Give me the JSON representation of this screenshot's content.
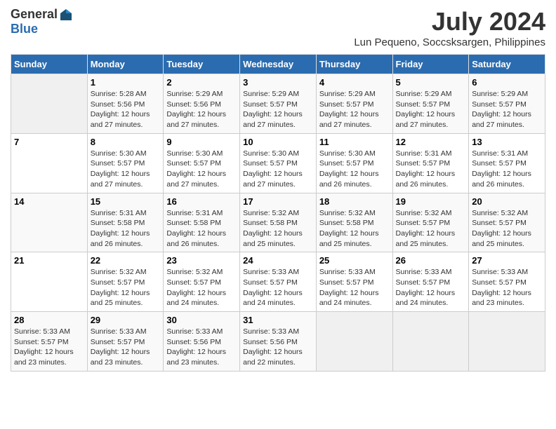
{
  "header": {
    "logo_general": "General",
    "logo_blue": "Blue",
    "month_year": "July 2024",
    "location": "Lun Pequeno, Soccsksargen, Philippines"
  },
  "calendar": {
    "days_of_week": [
      "Sunday",
      "Monday",
      "Tuesday",
      "Wednesday",
      "Thursday",
      "Friday",
      "Saturday"
    ],
    "weeks": [
      [
        {
          "day": "",
          "info": ""
        },
        {
          "day": "1",
          "info": "Sunrise: 5:28 AM\nSunset: 5:56 PM\nDaylight: 12 hours\nand 27 minutes."
        },
        {
          "day": "2",
          "info": "Sunrise: 5:29 AM\nSunset: 5:56 PM\nDaylight: 12 hours\nand 27 minutes."
        },
        {
          "day": "3",
          "info": "Sunrise: 5:29 AM\nSunset: 5:57 PM\nDaylight: 12 hours\nand 27 minutes."
        },
        {
          "day": "4",
          "info": "Sunrise: 5:29 AM\nSunset: 5:57 PM\nDaylight: 12 hours\nand 27 minutes."
        },
        {
          "day": "5",
          "info": "Sunrise: 5:29 AM\nSunset: 5:57 PM\nDaylight: 12 hours\nand 27 minutes."
        },
        {
          "day": "6",
          "info": "Sunrise: 5:29 AM\nSunset: 5:57 PM\nDaylight: 12 hours\nand 27 minutes."
        }
      ],
      [
        {
          "day": "7",
          "info": ""
        },
        {
          "day": "8",
          "info": "Sunrise: 5:30 AM\nSunset: 5:57 PM\nDaylight: 12 hours\nand 27 minutes."
        },
        {
          "day": "9",
          "info": "Sunrise: 5:30 AM\nSunset: 5:57 PM\nDaylight: 12 hours\nand 27 minutes."
        },
        {
          "day": "10",
          "info": "Sunrise: 5:30 AM\nSunset: 5:57 PM\nDaylight: 12 hours\nand 27 minutes."
        },
        {
          "day": "11",
          "info": "Sunrise: 5:30 AM\nSunset: 5:57 PM\nDaylight: 12 hours\nand 26 minutes."
        },
        {
          "day": "12",
          "info": "Sunrise: 5:31 AM\nSunset: 5:57 PM\nDaylight: 12 hours\nand 26 minutes."
        },
        {
          "day": "13",
          "info": "Sunrise: 5:31 AM\nSunset: 5:57 PM\nDaylight: 12 hours\nand 26 minutes."
        }
      ],
      [
        {
          "day": "14",
          "info": ""
        },
        {
          "day": "15",
          "info": "Sunrise: 5:31 AM\nSunset: 5:58 PM\nDaylight: 12 hours\nand 26 minutes."
        },
        {
          "day": "16",
          "info": "Sunrise: 5:31 AM\nSunset: 5:58 PM\nDaylight: 12 hours\nand 26 minutes."
        },
        {
          "day": "17",
          "info": "Sunrise: 5:32 AM\nSunset: 5:58 PM\nDaylight: 12 hours\nand 25 minutes."
        },
        {
          "day": "18",
          "info": "Sunrise: 5:32 AM\nSunset: 5:58 PM\nDaylight: 12 hours\nand 25 minutes."
        },
        {
          "day": "19",
          "info": "Sunrise: 5:32 AM\nSunset: 5:57 PM\nDaylight: 12 hours\nand 25 minutes."
        },
        {
          "day": "20",
          "info": "Sunrise: 5:32 AM\nSunset: 5:57 PM\nDaylight: 12 hours\nand 25 minutes."
        }
      ],
      [
        {
          "day": "21",
          "info": ""
        },
        {
          "day": "22",
          "info": "Sunrise: 5:32 AM\nSunset: 5:57 PM\nDaylight: 12 hours\nand 25 minutes."
        },
        {
          "day": "23",
          "info": "Sunrise: 5:32 AM\nSunset: 5:57 PM\nDaylight: 12 hours\nand 24 minutes."
        },
        {
          "day": "24",
          "info": "Sunrise: 5:33 AM\nSunset: 5:57 PM\nDaylight: 12 hours\nand 24 minutes."
        },
        {
          "day": "25",
          "info": "Sunrise: 5:33 AM\nSunset: 5:57 PM\nDaylight: 12 hours\nand 24 minutes."
        },
        {
          "day": "26",
          "info": "Sunrise: 5:33 AM\nSunset: 5:57 PM\nDaylight: 12 hours\nand 24 minutes."
        },
        {
          "day": "27",
          "info": "Sunrise: 5:33 AM\nSunset: 5:57 PM\nDaylight: 12 hours\nand 23 minutes."
        }
      ],
      [
        {
          "day": "28",
          "info": "Sunrise: 5:33 AM\nSunset: 5:57 PM\nDaylight: 12 hours\nand 23 minutes."
        },
        {
          "day": "29",
          "info": "Sunrise: 5:33 AM\nSunset: 5:57 PM\nDaylight: 12 hours\nand 23 minutes."
        },
        {
          "day": "30",
          "info": "Sunrise: 5:33 AM\nSunset: 5:56 PM\nDaylight: 12 hours\nand 23 minutes."
        },
        {
          "day": "31",
          "info": "Sunrise: 5:33 AM\nSunset: 5:56 PM\nDaylight: 12 hours\nand 22 minutes."
        },
        {
          "day": "",
          "info": ""
        },
        {
          "day": "",
          "info": ""
        },
        {
          "day": "",
          "info": ""
        }
      ]
    ]
  }
}
